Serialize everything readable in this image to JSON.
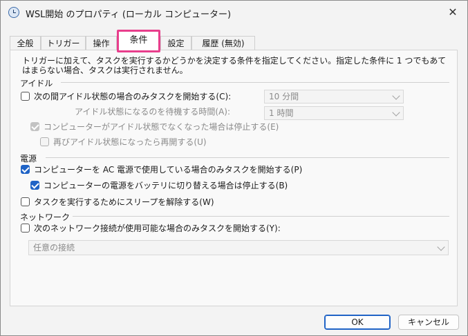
{
  "window": {
    "title": "WSL開始 のプロパティ (ローカル コンピューター)",
    "close_glyph": "✕"
  },
  "tabs": [
    {
      "label": "全般"
    },
    {
      "label": "トリガー"
    },
    {
      "label": "操作"
    },
    {
      "label": "条件",
      "active": true
    },
    {
      "label": "設定"
    },
    {
      "label": "履歴 (無効)"
    }
  ],
  "description": "トリガーに加えて、タスクを実行するかどうかを決定する条件を指定してください。指定した条件に 1 つでもあてはまらない場合、タスクは実行されません。",
  "idle": {
    "group_label": "アイドル",
    "start_only_if_idle": {
      "label": "次の間アイドル状態の場合のみタスクを開始する(C):",
      "checked": false
    },
    "idle_duration": "10 分間",
    "wait_label": "アイドル状態になるのを待機する時間(A):",
    "wait_duration": "1 時間",
    "stop_if_not_idle": {
      "label": "コンピューターがアイドル状態でなくなった場合は停止する(E)",
      "checked": true,
      "disabled": true
    },
    "restart_if_idle": {
      "label": "再びアイドル状態になったら再開する(U)",
      "checked": false,
      "disabled": true
    }
  },
  "power": {
    "group_label": "電源",
    "ac_only": {
      "label": "コンピューターを AC 電源で使用している場合のみタスクを開始する(P)",
      "checked": true
    },
    "stop_on_battery": {
      "label": "コンピューターの電源をバッテリに切り替える場合は停止する(B)",
      "checked": true
    },
    "wake_to_run": {
      "label": "タスクを実行するためにスリープを解除する(W)",
      "checked": false
    }
  },
  "network": {
    "group_label": "ネットワーク",
    "network_only": {
      "label": "次のネットワーク接続が使用可能な場合のみタスクを開始する(Y):",
      "checked": false
    },
    "connection": "任意の接続"
  },
  "buttons": {
    "ok": "OK",
    "cancel": "キャンセル"
  },
  "colors": {
    "accent": "#1f63c6",
    "highlight": "#e83e8c"
  }
}
